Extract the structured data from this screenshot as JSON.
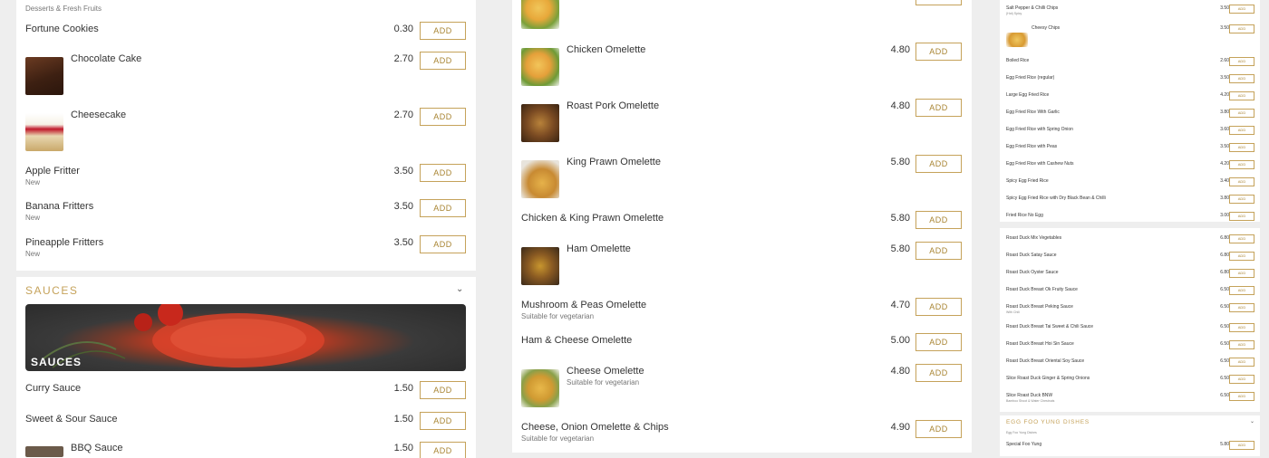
{
  "col1": {
    "top_subtitle": "Desserts & Fresh Fruits",
    "items": [
      {
        "name": "Fortune Cookies",
        "price": "0.30",
        "add": "ADD"
      },
      {
        "name": "Chocolate Cake",
        "price": "2.70",
        "add": "ADD",
        "thumb": "chocolate-cake"
      },
      {
        "name": "Cheesecake",
        "price": "2.70",
        "add": "ADD",
        "thumb": "cheesecake"
      },
      {
        "name": "Apple Fritter",
        "sub": "New",
        "price": "3.50",
        "add": "ADD"
      },
      {
        "name": "Banana Fritters",
        "sub": "New",
        "price": "3.50",
        "add": "ADD"
      },
      {
        "name": "Pineapple Fritters",
        "sub": "New",
        "price": "3.50",
        "add": "ADD"
      }
    ]
  },
  "sauces": {
    "heading": "SAUCES",
    "banner_label": "SAUCES",
    "items": [
      {
        "name": "Curry Sauce",
        "price": "1.50",
        "add": "ADD"
      },
      {
        "name": "Sweet & Sour Sauce",
        "price": "1.50",
        "add": "ADD"
      },
      {
        "name": "BBQ Sauce",
        "price": "1.50",
        "add": "ADD"
      }
    ]
  },
  "col2": {
    "items": [
      {
        "name": "Chicken Omelette",
        "price": "4.80",
        "add": "ADD"
      },
      {
        "name": "Roast Pork Omelette",
        "price": "4.80",
        "add": "ADD"
      },
      {
        "name": "King Prawn Omelette",
        "price": "5.80",
        "add": "ADD"
      },
      {
        "name": "Chicken & King Prawn Omelette",
        "price": "5.80",
        "add": "ADD"
      },
      {
        "name": "Ham Omelette",
        "price": "5.80",
        "add": "ADD"
      },
      {
        "name": "Mushroom & Peas Omelette",
        "sub": "Suitable for vegetarian",
        "price": "4.70",
        "add": "ADD"
      },
      {
        "name": "Ham & Cheese Omelette",
        "price": "5.00",
        "add": "ADD"
      },
      {
        "name": "Cheese Omelette",
        "sub": "Suitable for vegetarian",
        "price": "4.80",
        "add": "ADD"
      },
      {
        "name": "Cheese, Onion Omelette & Chips",
        "sub": "Suitable for vegetarian",
        "price": "4.90",
        "add": "ADD"
      }
    ]
  },
  "col3": {
    "rice_items": [
      {
        "name": "Salt Pepper & Chilli Chips",
        "sub": "(Hot) Spicy",
        "price": "3.50",
        "add": "ADD"
      },
      {
        "name": "Cheesy Chips",
        "price": "3.50",
        "add": "ADD"
      },
      {
        "name": "Boiled Rice",
        "price": "2.60",
        "add": "ADD"
      },
      {
        "name": "Egg Fried Rice (regular)",
        "price": "3.50",
        "add": "ADD"
      },
      {
        "name": "Large Egg Fried Rice",
        "price": "4.20",
        "add": "ADD"
      },
      {
        "name": "Egg Fried Rice With Garlic",
        "price": "3.80",
        "add": "ADD"
      },
      {
        "name": "Egg Fried Rice with Spring Onion",
        "price": "3.60",
        "add": "ADD"
      },
      {
        "name": "Egg Fried Rice with Peas",
        "price": "3.50",
        "add": "ADD"
      },
      {
        "name": "Egg Fried Rice with Cashew Nuts",
        "price": "4.20",
        "add": "ADD"
      },
      {
        "name": "Spicy Egg Fried Rice",
        "price": "3.40",
        "add": "ADD"
      },
      {
        "name": "Spicy Egg Fried Rice with Dry Black Bean & Chilli",
        "price": "3.80",
        "add": "ADD"
      },
      {
        "name": "Fried Rice No Egg",
        "price": "3.00",
        "add": "ADD"
      }
    ],
    "duck_items": [
      {
        "name": "Roast Duck Mix Vegetables",
        "price": "6.80",
        "add": "ADD"
      },
      {
        "name": "Roast Duck Satay Sauce",
        "price": "6.80",
        "add": "ADD"
      },
      {
        "name": "Roast Duck Oyster Sauce",
        "price": "6.80",
        "add": "ADD"
      },
      {
        "name": "Roast Duck Breast Ok Fruity Sauce",
        "price": "6.50",
        "add": "ADD"
      },
      {
        "name": "Roast Duck Breast Peking Sauce",
        "sub": "With Chili",
        "price": "6.50",
        "add": "ADD"
      },
      {
        "name": "Roast Duck Breast Tai Sweet & Chili Sauce",
        "price": "6.50",
        "add": "ADD"
      },
      {
        "name": "Roast Duck Breast Hoi Sin Sauce",
        "price": "6.50",
        "add": "ADD"
      },
      {
        "name": "Roast Duck Breast Oriental Soy Sauce",
        "price": "6.50",
        "add": "ADD"
      },
      {
        "name": "Slice Roast Duck Ginger & Spring Onions",
        "price": "6.50",
        "add": "ADD"
      },
      {
        "name": "Slice Roast Duck BNW",
        "sub": "Bamboo Shoot & Water Chestnuts",
        "price": "6.50",
        "add": "ADD"
      }
    ],
    "foo_yung": {
      "heading": "EGG FOO YUNG DISHES",
      "sub": "Egg Foo Yung Dishes",
      "items": [
        {
          "name": "Special Foo Yung",
          "price": "5.80",
          "add": "ADD"
        }
      ]
    }
  },
  "colors": {
    "accent": "#c5a25a",
    "button_text": "#a88432",
    "page_bg": "#eeeeee"
  }
}
